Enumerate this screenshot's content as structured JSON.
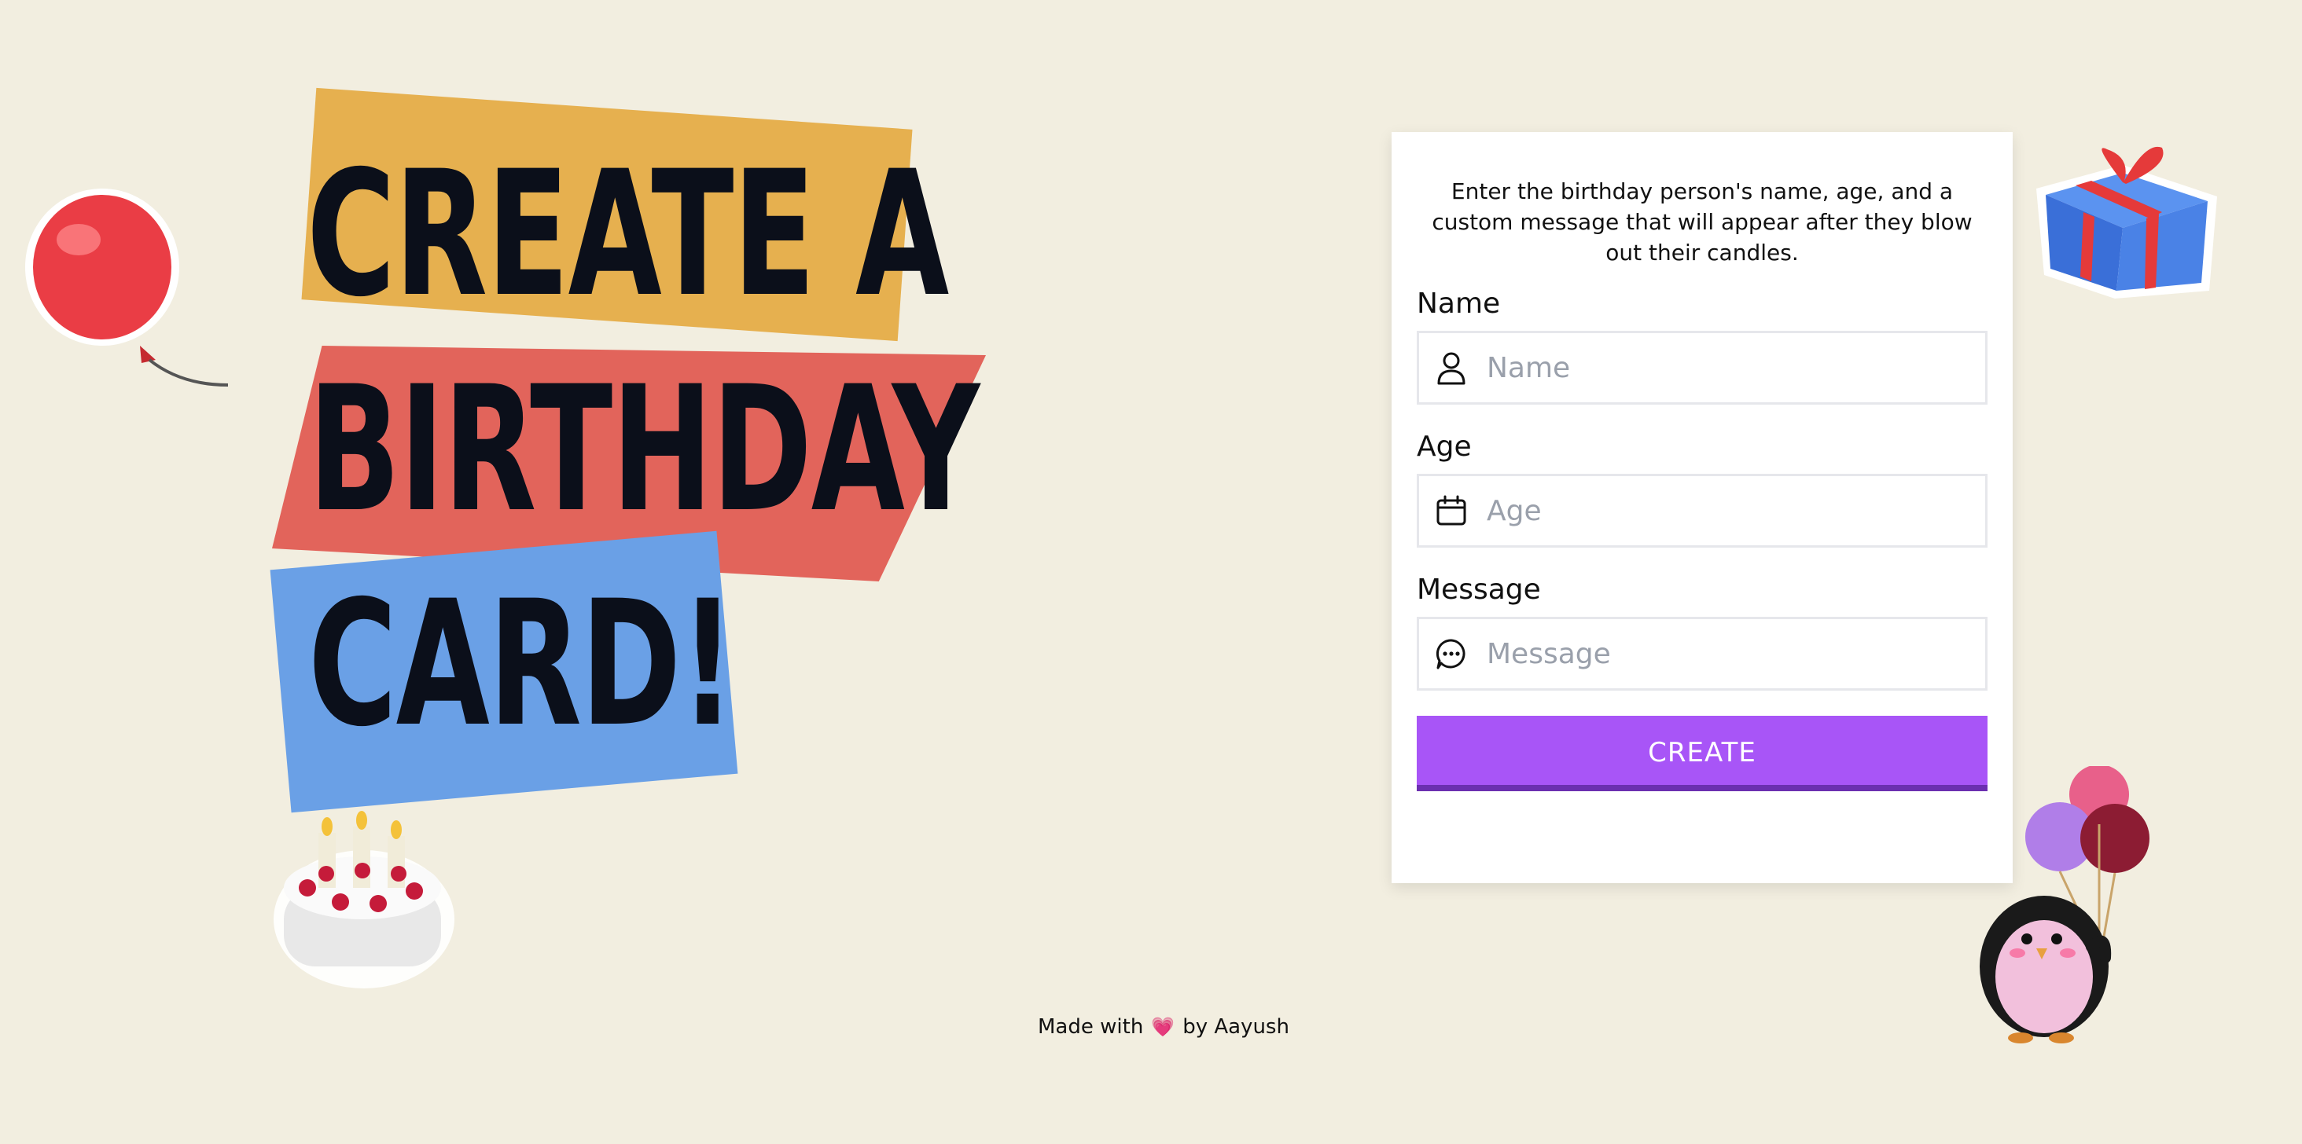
{
  "hero": {
    "line1": "CREATE A",
    "line2": "BIRTHDAY",
    "line3": "CARD!"
  },
  "colors": {
    "background": "#f2eee0",
    "band_yellow": "#e6b04f",
    "band_red": "#e2645b",
    "band_blue": "#6aa0e6",
    "accent": "#a855f7"
  },
  "form": {
    "intro": "Enter the birthday person's name, age, and a custom message that will appear after they blow out their candles.",
    "fields": {
      "name": {
        "label": "Name",
        "placeholder": "Name",
        "value": "",
        "icon": "person-icon"
      },
      "age": {
        "label": "Age",
        "placeholder": "Age",
        "value": "",
        "icon": "calendar-icon"
      },
      "message": {
        "label": "Message",
        "placeholder": "Message",
        "value": "",
        "icon": "chat-bubble-icon"
      }
    },
    "submit_label": "CREATE"
  },
  "stickers": [
    "balloon-sticker",
    "cake-sticker",
    "gift-sticker",
    "penguin-balloons-sticker"
  ],
  "footer": {
    "made_with": "Made with",
    "heart_icon": "heart-icon",
    "by": "by Aayush"
  }
}
